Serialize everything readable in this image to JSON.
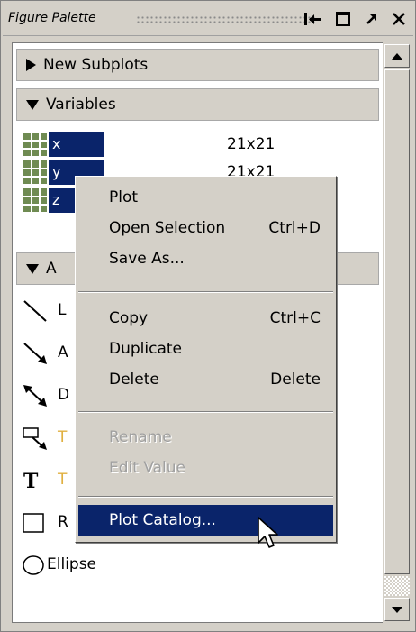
{
  "window": {
    "title": "Figure Palette",
    "buttons": {
      "undock": "⭲",
      "maximize": "□",
      "popout": "↗",
      "close": "✕"
    }
  },
  "sections": {
    "new_subplots": "New Subplots",
    "variables": "Variables",
    "annotations_partial": "A"
  },
  "variables": [
    {
      "name": "x",
      "size": "21x21"
    },
    {
      "name": "y",
      "size": "21x21"
    },
    {
      "name": "z",
      "size": ""
    }
  ],
  "annotations": [
    {
      "label": "L",
      "icon": "line-icon"
    },
    {
      "label": "A",
      "icon": "arrow-icon"
    },
    {
      "label": "D",
      "icon": "double-arrow-icon"
    },
    {
      "label": "T",
      "icon": "text-arrow-icon"
    },
    {
      "label": "T",
      "icon": "text-box-icon"
    },
    {
      "label": "R",
      "icon": "rectangle-icon"
    },
    {
      "label": "Ellipse",
      "icon": "ellipse-icon"
    }
  ],
  "context_menu": {
    "items": [
      {
        "label": "Plot",
        "shortcut": "",
        "enabled": true
      },
      {
        "label": "Open Selection",
        "shortcut": "Ctrl+D",
        "enabled": true
      },
      {
        "label": "Save As...",
        "shortcut": "",
        "enabled": true
      },
      {
        "label": "Copy",
        "shortcut": "Ctrl+C",
        "enabled": true
      },
      {
        "label": "Duplicate",
        "shortcut": "",
        "enabled": true
      },
      {
        "label": "Delete",
        "shortcut": "Delete",
        "enabled": true
      },
      {
        "label": "Rename",
        "shortcut": "",
        "enabled": false
      },
      {
        "label": "Edit Value",
        "shortcut": "",
        "enabled": false
      },
      {
        "label": "Plot Catalog...",
        "shortcut": "",
        "enabled": true,
        "highlighted": true
      }
    ]
  },
  "colors": {
    "selection": "#0a246a",
    "chrome": "#d4d0c8",
    "variable_icon": "#6f8b52"
  }
}
